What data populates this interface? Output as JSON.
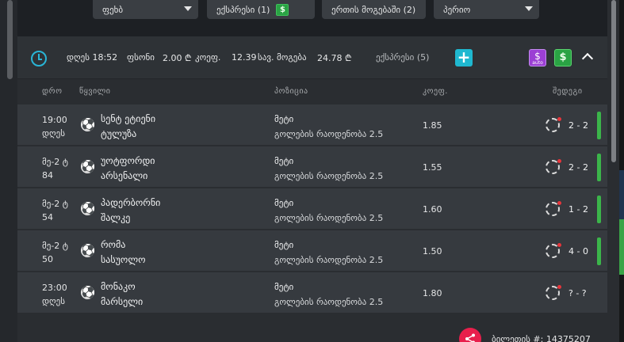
{
  "filters": {
    "sport_label": "ფეხბ",
    "express_label": "ექსპრესი (1)",
    "single_label": "ერთის მოგებაში (2)",
    "period_label": "პერიო"
  },
  "ticket": {
    "time": "დღეს 18:52",
    "stake_label": "ფსონი",
    "stake_value": "2.00 ₾",
    "coef_label": "კოეფ.",
    "coef_value": "12.39",
    "win_label": "სავ. მოგება",
    "win_value": "24.78 ₾",
    "express": "ექსპრესი (5)",
    "auto_label": "auto",
    "ticket_number": "ბილეთის #: 14375207"
  },
  "columns": {
    "time": "დრო",
    "pair": "წყვილი",
    "position": "პოზიცია",
    "coef": "კოეფ.",
    "results": "შედეგი"
  },
  "rows": [
    {
      "time1": "19:00",
      "time2": "დღეს",
      "team1": "სენტ ეტიენი",
      "team2": "ტულუზა",
      "pick": "მეტი",
      "market": "გოლების რაოდენობა 2.5",
      "odd": "1.85",
      "score": "2 - 2"
    },
    {
      "time1": "მე-2 ტ",
      "time2": "84",
      "team1": "უოტფორდი",
      "team2": "არსენალი",
      "pick": "მეტი",
      "market": "გოლების რაოდენობა 2.5",
      "odd": "1.55",
      "score": "2 - 2"
    },
    {
      "time1": "მე-2 ტ",
      "time2": "54",
      "team1": "პადერბორნი",
      "team2": "შალკე",
      "pick": "მეტი",
      "market": "გოლების რაოდენობა 2.5",
      "odd": "1.60",
      "score": "1 - 2"
    },
    {
      "time1": "მე-2 ტ",
      "time2": "50",
      "team1": "რომა",
      "team2": "სასუოლო",
      "pick": "მეტი",
      "market": "გოლების რაოდენობა 2.5",
      "odd": "1.50",
      "score": "4 - 0"
    },
    {
      "time1": "23:00",
      "time2": "დღეს",
      "team1": "მონაკო",
      "team2": "მარსელი",
      "pick": "მეტი",
      "market": "გოლების რაოდენობა 2.5",
      "odd": "1.80",
      "score": "? - ?"
    }
  ],
  "icons": {
    "clock": "clock-icon",
    "plus": "plus-icon",
    "money": "money-icon",
    "auto": "auto-icon",
    "collapse": "chevron-up-icon",
    "ball": "football-icon",
    "loading": "spinner-icon",
    "share": "share-icon"
  },
  "colors": {
    "accent_cyan": "#1fb8d0",
    "live_green": "#3bb54a",
    "share_red": "#e81f4c",
    "auto_purple": "#9b3fd4"
  }
}
